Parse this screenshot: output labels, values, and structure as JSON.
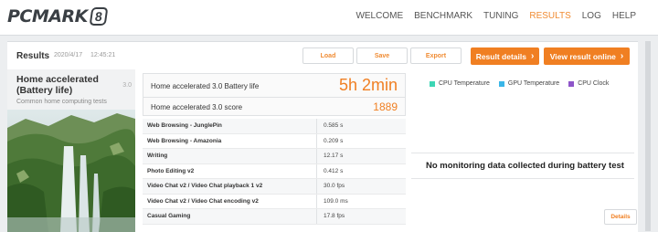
{
  "app": {
    "logo_text": "PCMARK",
    "logo_version": "8"
  },
  "nav": {
    "items": [
      {
        "label": "WELCOME"
      },
      {
        "label": "BENCHMARK"
      },
      {
        "label": "TUNING"
      },
      {
        "label": "RESULTS",
        "active": true
      },
      {
        "label": "LOG"
      },
      {
        "label": "HELP"
      }
    ],
    "active_color": "#f08b32"
  },
  "results": {
    "title": "Results",
    "date": "2020/4/17",
    "time": "12:45:21",
    "buttons": {
      "load": "Load",
      "save": "Save",
      "export": "Export",
      "result_details": "Result details",
      "view_online": "View result online"
    }
  },
  "test": {
    "name": "Home accelerated (Battery life)",
    "version": "3.0",
    "description": "Common home computing tests"
  },
  "scores": {
    "battery_label": "Home accelerated 3.0 Battery life",
    "battery_value": "5h 2min",
    "score_label": "Home accelerated 3.0 score",
    "score_value": "1889"
  },
  "subtests": [
    {
      "name": "Web Browsing - JunglePin",
      "value": "0.585 s"
    },
    {
      "name": "Web Browsing - Amazonia",
      "value": "0.209 s"
    },
    {
      "name": "Writing",
      "value": "12.17 s"
    },
    {
      "name": "Photo Editing v2",
      "value": "0.412 s"
    },
    {
      "name": "Video Chat v2 / Video Chat playback 1 v2",
      "value": "30.0 fps"
    },
    {
      "name": "Video Chat v2 / Video Chat encoding v2",
      "value": "109.0 ms"
    },
    {
      "name": "Casual Gaming",
      "value": "17.8 fps"
    }
  ],
  "monitoring": {
    "legend": [
      {
        "label": "CPU Temperature",
        "color": "#3dd6b5"
      },
      {
        "label": "GPU Temperature",
        "color": "#3ab6e8"
      },
      {
        "label": "CPU Clock",
        "color": "#8e55c9"
      }
    ],
    "message": "No monitoring data collected during battery test",
    "details_button": "Details"
  },
  "colors": {
    "accent": "#f07f22"
  }
}
